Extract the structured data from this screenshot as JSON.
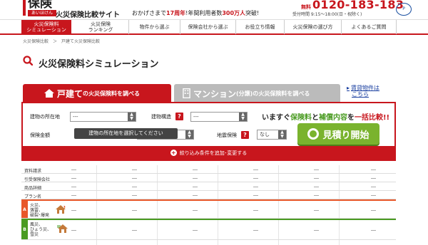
{
  "header": {
    "logo_main": "保険",
    "logo_sub": "あいほけん",
    "site_title": "火災保険比較サイト",
    "tagline_prefix": "おかげさまで",
    "tagline_years": "17周年",
    "tagline_mid": "!年間利用者数",
    "tagline_users": "300万人",
    "tagline_suffix": "突破!",
    "phone_free": "無料",
    "phone": "0120-183-183",
    "hours": "受付時間 9:15～18:00(日・祝除く)",
    "badge": "P"
  },
  "nav": {
    "items": [
      {
        "label1": "火災保険料",
        "label2": "シミュレーション"
      },
      {
        "label1": "火災保険",
        "label2": "ランキング"
      },
      {
        "label1": "物件から選ぶ",
        "label2": ""
      },
      {
        "label1": "保険会社から選ぶ",
        "label2": ""
      },
      {
        "label1": "お役立ち情報",
        "label2": ""
      },
      {
        "label1": "火災保険の選び方",
        "label2": ""
      },
      {
        "label1": "よくあるご質問",
        "label2": ""
      }
    ]
  },
  "breadcrumb": {
    "items": [
      "火災保険比較",
      "＞",
      "戸建て火災保険比較"
    ]
  },
  "page_title": "火災保険料シミュレーション",
  "tabs": {
    "house_big": "戸建て",
    "house_small": "の火災保険料を調べる",
    "mansion_big": "マンション",
    "mansion_paren": "(分譲)",
    "mansion_small": "の火災保険料を調べる",
    "link_line1": "賃貸物件は",
    "link_line2": "こちら"
  },
  "form": {
    "location_label": "建物の所在地",
    "location_value": "---",
    "structure_label": "建物構造",
    "structure_value": "---",
    "amount_label": "保険金額",
    "amount_value": "---",
    "earthquake_label": "地震保険",
    "earthquake_value": "なし",
    "question_mark": "?",
    "tooltip": "建物の所在地を選択してください",
    "cta_prefix": "いますぐ",
    "cta_premium": "保険料",
    "cta_and": "と",
    "cta_coverage": "補償内容",
    "cta_mid": "を",
    "cta_compare": "一括比較!!",
    "estimate_button": "見積り開始",
    "add_conditions": "絞り込み条件を追加･変更する"
  },
  "table": {
    "rows": [
      {
        "label": "資料請求"
      },
      {
        "label": "引受保険会社"
      },
      {
        "label": "商品詳細"
      },
      {
        "label": "プラン名"
      }
    ],
    "dash": "―",
    "category_a": {
      "marker": "A",
      "line1": "火災、",
      "line2": "落雷、",
      "line3": "破裂･爆発"
    },
    "category_b": {
      "marker": "B",
      "line1": "風災、",
      "line2": "ひょう災、",
      "line3": "雪災"
    }
  },
  "colors": {
    "brand_red": "#c8161d",
    "cta_green": "#7ab32e",
    "cat_a": "#e8572a",
    "cat_b": "#4a9b22",
    "link_blue": "#1a3fa0"
  }
}
